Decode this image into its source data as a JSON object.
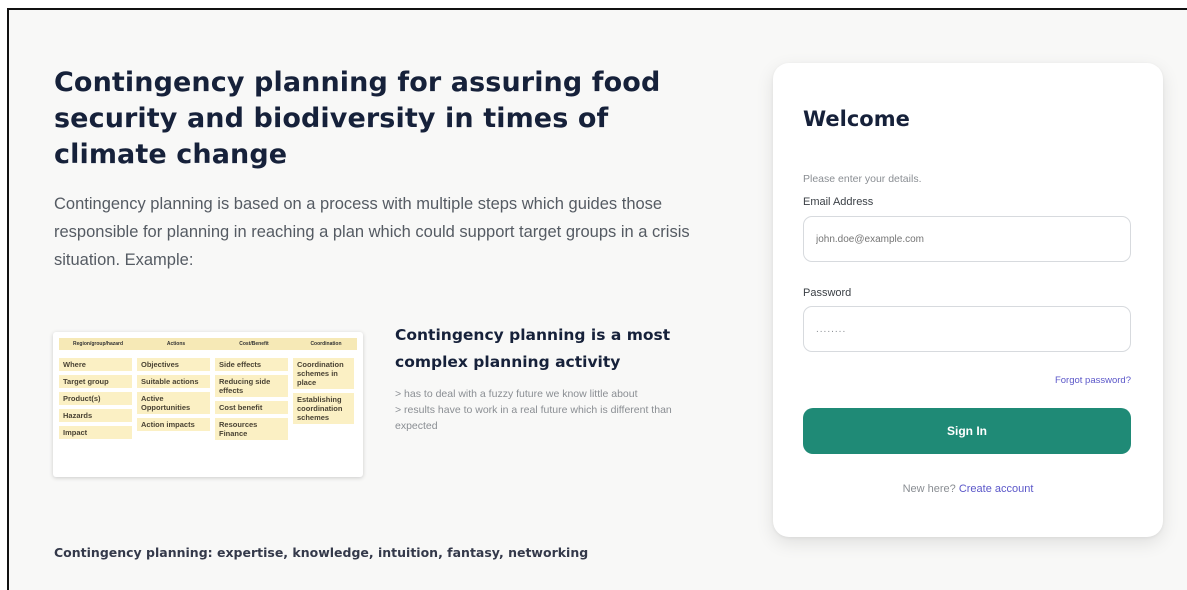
{
  "hero": {
    "title": "Contingency planning for assuring food security and biodiversity in times of climate change",
    "description": "Contingency planning is based on a process with multiple steps which guides those responsible for planning in reaching a plan which could support target groups in a crisis situation. Example:"
  },
  "planning_table": {
    "headers": [
      "Region/group/hazard",
      "Actions",
      "Cost/Benefit",
      "Coordination"
    ],
    "columns": [
      [
        "Where",
        "Target group",
        "Product(s)",
        "Hazards",
        "Impact"
      ],
      [
        "Objectives",
        "Suitable actions",
        "Active Opportunities",
        "Action impacts"
      ],
      [
        "Side effects",
        "Reducing side effects",
        "Cost benefit",
        "Resources Finance"
      ],
      [
        "Coordination schemes in place",
        "Establishing coordination schemes"
      ]
    ]
  },
  "side": {
    "title": "Contingency planning is a most complex planning activity",
    "bullet1": "> has to deal with a fuzzy future we know little about",
    "bullet2": "> results have to work in a real future which is different than expected"
  },
  "footer": {
    "note": "Contingency planning: expertise, knowledge, intuition, fantasy, networking"
  },
  "login": {
    "title": "Welcome",
    "subtitle": "Please enter your details.",
    "email_label": "Email Address",
    "email_placeholder": "john.doe@example.com",
    "password_label": "Password",
    "password_value": "........",
    "forgot_label": "Forgot password?",
    "signin_label": "Sign In",
    "new_here_label": "New here?",
    "create_account_label": "Create account"
  },
  "colors": {
    "accent": "#1f8a76",
    "link": "#5b57c9",
    "heading": "#16213a",
    "table_cell": "#fbf0c4"
  }
}
